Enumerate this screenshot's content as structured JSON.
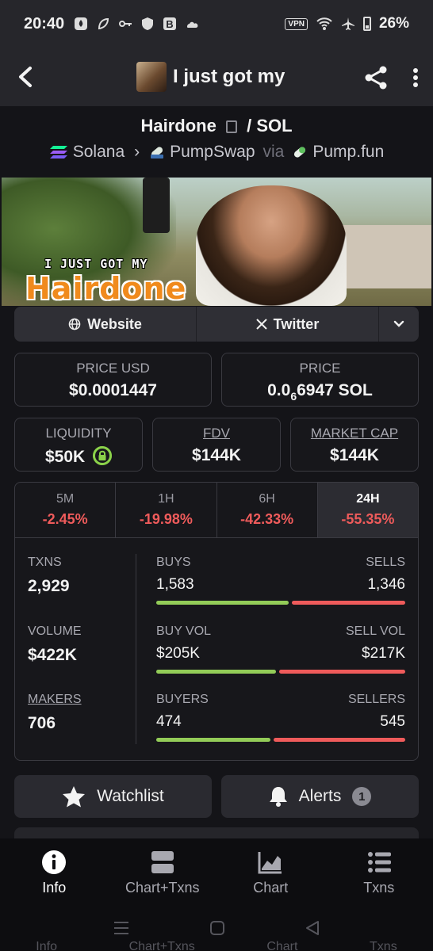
{
  "status_bar": {
    "time": "20:40",
    "vpn": "VPN",
    "battery": "26%",
    "icons": [
      "drop-icon",
      "leaf-icon",
      "key-icon",
      "shield-icon",
      "b-icon",
      "cloud-icon",
      "wifi-icon",
      "airplane-icon",
      "battery-icon"
    ]
  },
  "header": {
    "title": "I just got my",
    "back_icon": "chevron-left-icon",
    "share_icon": "share-icon",
    "more_icon": "more-vertical-icon"
  },
  "pair": {
    "base": "Hairdone",
    "separator": "/",
    "quote": "SOL",
    "chain": "Solana",
    "dex": "PumpSwap",
    "via": "via",
    "launchpad": "Pump.fun"
  },
  "banner": {
    "caption_top": "I JUST GOT MY",
    "caption_main": "Hairdone"
  },
  "links": {
    "website": "Website",
    "twitter": "Twitter"
  },
  "metrics": {
    "price_usd_label": "PRICE USD",
    "price_usd": "$0.0001447",
    "price_label": "PRICE",
    "price_prefix": "0.0",
    "price_sub": "6",
    "price_rest": "6947 SOL",
    "liquidity_label": "LIQUIDITY",
    "liquidity": "$50K",
    "fdv_label": "FDV",
    "fdv": "$144K",
    "mcap_label": "MARKET CAP",
    "mcap": "$144K"
  },
  "tabs": [
    {
      "label": "5M",
      "value": "-2.45%"
    },
    {
      "label": "1H",
      "value": "-19.98%"
    },
    {
      "label": "6H",
      "value": "-42.33%"
    },
    {
      "label": "24H",
      "value": "-55.35%"
    }
  ],
  "stats": {
    "txns_label": "TXNS",
    "txns": "2,929",
    "buys_label": "BUYS",
    "buys": "1,583",
    "sells_label": "SELLS",
    "sells": "1,346",
    "volume_label": "VOLUME",
    "volume": "$422K",
    "buy_vol_label": "BUY VOL",
    "buy_vol": "$205K",
    "sell_vol_label": "SELL VOL",
    "sell_vol": "$217K",
    "makers_label": "MAKERS",
    "makers": "706",
    "buyers_label": "BUYERS",
    "buyers": "474",
    "sellers_label": "SELLERS",
    "sellers": "545",
    "buys_share": 0.54,
    "buy_vol_share": 0.486,
    "buyers_share": 0.465
  },
  "actions": {
    "watchlist": "Watchlist",
    "alerts": "Alerts",
    "alerts_count": "1"
  },
  "bottom_nav": [
    {
      "label": "Info",
      "icon": "info-icon"
    },
    {
      "label": "Chart+Txns",
      "icon": "chart-txns-icon"
    },
    {
      "label": "Chart",
      "icon": "chart-icon"
    },
    {
      "label": "Txns",
      "icon": "list-icon"
    }
  ],
  "ghost_labels": [
    "Info",
    "Chart+Txns",
    "Chart",
    "Txns"
  ],
  "colors": {
    "negative": "#ef5b5b",
    "positive": "#93cc58",
    "background": "#141418"
  }
}
